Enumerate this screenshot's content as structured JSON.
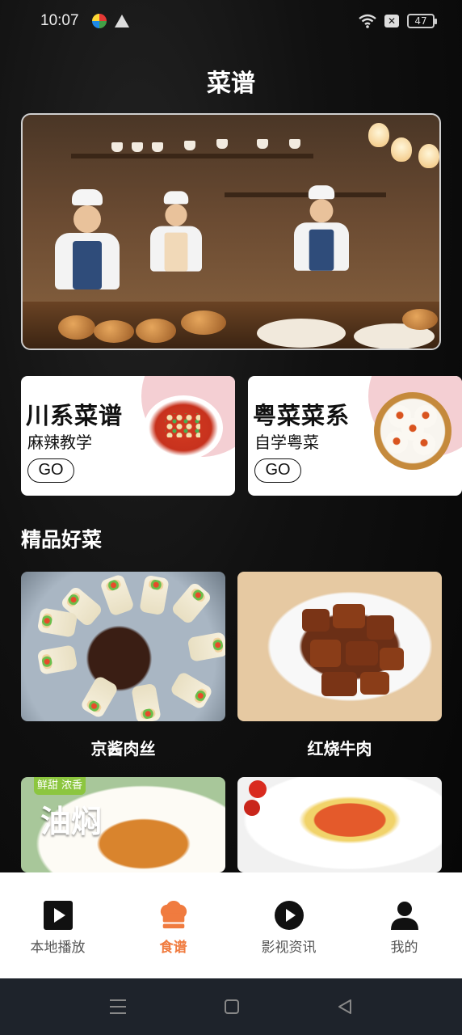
{
  "status_bar": {
    "time": "10:07",
    "battery": "47"
  },
  "page": {
    "title": "菜谱"
  },
  "categories": [
    {
      "title": "川系菜谱",
      "subtitle": "麻辣教学",
      "button": "GO"
    },
    {
      "title": "粤菜菜系",
      "subtitle": "自学粤菜",
      "button": "GO"
    }
  ],
  "section": {
    "title": "精品好菜"
  },
  "dishes": [
    {
      "name": "京酱肉丝"
    },
    {
      "name": "红烧牛肉"
    },
    {
      "name": "",
      "badge": "鲜甜 浓香",
      "overlay": "油焖"
    },
    {
      "name": ""
    }
  ],
  "bottom_nav": {
    "items": [
      {
        "label": "本地播放",
        "icon": "play-square-icon"
      },
      {
        "label": "食谱",
        "icon": "chef-hat-icon",
        "active": true
      },
      {
        "label": "影视资讯",
        "icon": "play-circle-icon"
      },
      {
        "label": "我的",
        "icon": "user-icon"
      }
    ]
  },
  "colors": {
    "accent": "#f07b3f",
    "card_blob": "#f4cfd3",
    "system_nav": "#1e232b"
  }
}
